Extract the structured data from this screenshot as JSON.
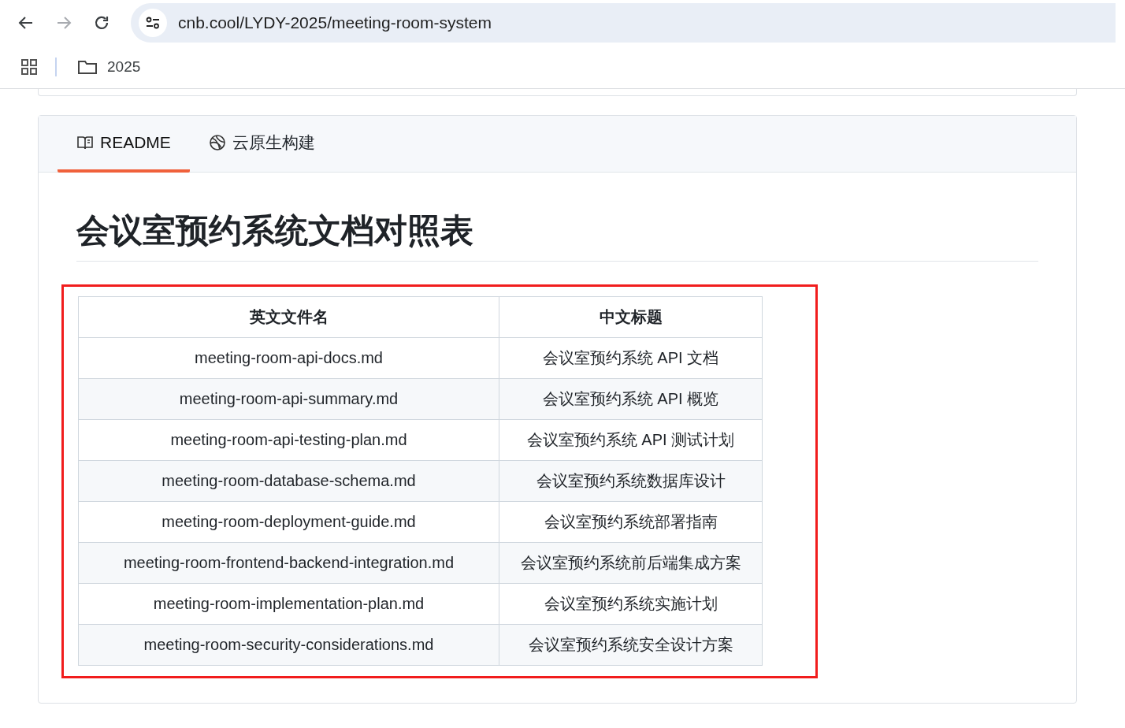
{
  "browser": {
    "url": "cnb.cool/LYDY-2025/meeting-room-system",
    "forward_disabled": true,
    "bookmarks": [
      {
        "label": "2025"
      }
    ]
  },
  "tabs": [
    {
      "label": "README",
      "selected": true
    },
    {
      "label": "云原生构建",
      "selected": false
    }
  ],
  "readme": {
    "heading": "会议室预约系统文档对照表",
    "highlighted": true,
    "table": {
      "columns": [
        "英文文件名",
        "中文标题"
      ],
      "rows": [
        [
          "meeting-room-api-docs.md",
          "会议室预约系统 API 文档"
        ],
        [
          "meeting-room-api-summary.md",
          "会议室预约系统 API 概览"
        ],
        [
          "meeting-room-api-testing-plan.md",
          "会议室预约系统 API 测试计划"
        ],
        [
          "meeting-room-database-schema.md",
          "会议室预约系统数据库设计"
        ],
        [
          "meeting-room-deployment-guide.md",
          "会议室预约系统部署指南"
        ],
        [
          "meeting-room-frontend-backend-integration.md",
          "会议室预约系统前后端集成方案"
        ],
        [
          "meeting-room-implementation-plan.md",
          "会议室预约系统实施计划"
        ],
        [
          "meeting-room-security-considerations.md",
          "会议室预约系统安全设计方案"
        ]
      ]
    }
  }
}
